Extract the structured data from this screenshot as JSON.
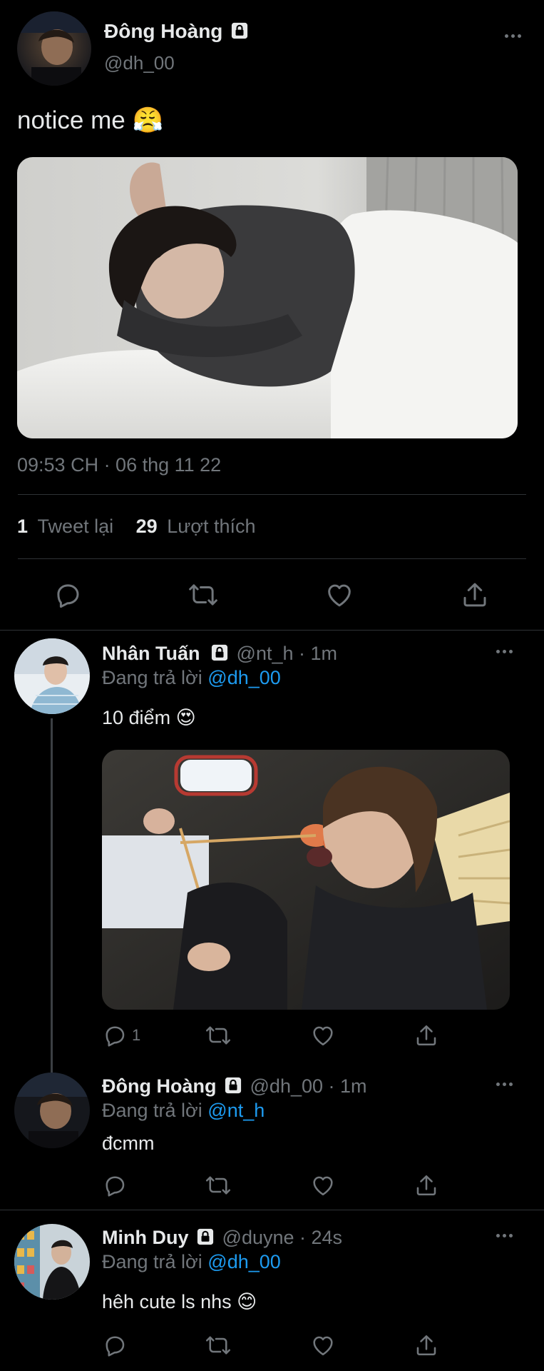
{
  "main_tweet": {
    "author_name": "Đông Hoàng",
    "handle": "@dh_00",
    "text": "notice me",
    "emoji": "😤",
    "timestamp": "09:53 CH · 06 thg 11 22",
    "retweet_count": "1",
    "retweet_label": "Tweet lại",
    "like_count": "29",
    "like_label": "Lượt thích"
  },
  "replies": [
    {
      "author_name": "Nhân Tuấn",
      "handle": "@nt_h",
      "time": "· 1m",
      "replying_prefix": "Đang trả lời",
      "replying_to": "@dh_00",
      "text": "10 điểm",
      "emoji": "😍",
      "reply_count": "1"
    },
    {
      "author_name": "Đông Hoàng",
      "handle": "@dh_00",
      "time": "· 1m",
      "replying_prefix": "Đang trả lời",
      "replying_to": "@nt_h",
      "text": "đcmm",
      "emoji": "",
      "reply_count": ""
    },
    {
      "author_name": "Minh Duy",
      "handle": "@duyne",
      "time": "· 24s",
      "replying_prefix": "Đang trả lời",
      "replying_to": "@dh_00",
      "text": "hêh cute ls nhs",
      "emoji": "😊",
      "reply_count": ""
    }
  ],
  "icons": [
    "lock-icon",
    "more-icon",
    "reply-icon",
    "retweet-icon",
    "like-icon",
    "share-icon"
  ],
  "colors": {
    "background": "#000000",
    "text": "#e7e9ea",
    "muted": "#71767b",
    "accent": "#1d9bf0",
    "divider": "#2f3336"
  }
}
